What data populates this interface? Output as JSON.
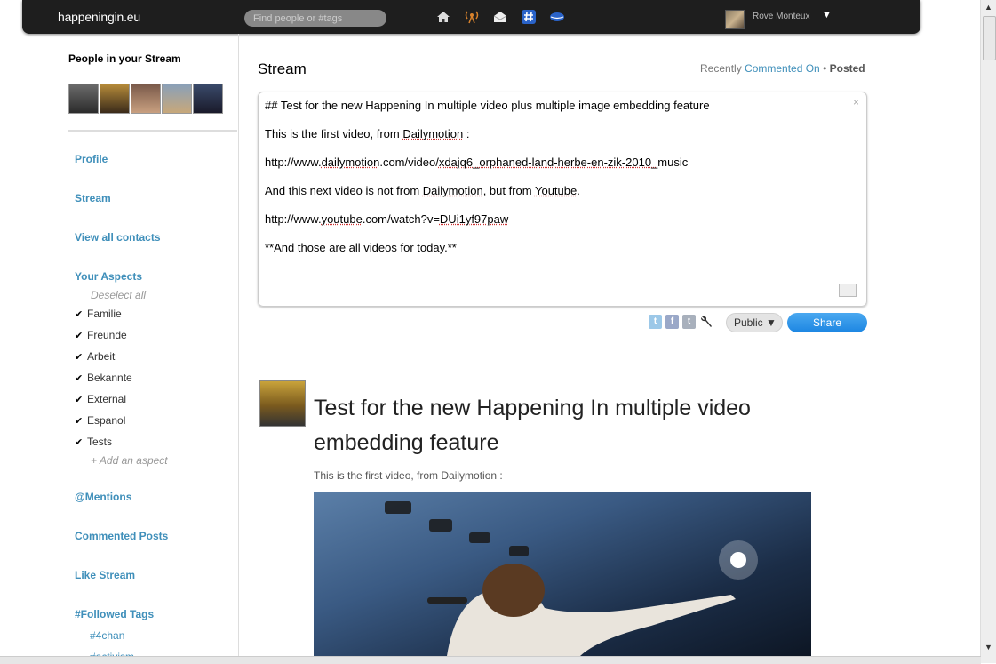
{
  "header": {
    "brand": "happeningin.eu",
    "search_placeholder": "Find people or #tags",
    "icons": [
      "home-icon",
      "broadcast-icon",
      "mail-icon",
      "hashtag-icon",
      "lips-icon"
    ],
    "user_name": "Rove Monteux",
    "user_menu_caret": "▼"
  },
  "sidebar": {
    "people_title": "People in your Stream",
    "nav": {
      "profile": "Profile",
      "stream": "Stream",
      "view_all_contacts": "View all contacts",
      "your_aspects": "Your Aspects",
      "deselect_all": "Deselect all",
      "add_aspect": "+ Add an aspect",
      "mentions": "@Mentions",
      "commented_posts": "Commented Posts",
      "like_stream": "Like Stream",
      "followed_tags": "#Followed Tags"
    },
    "aspects": [
      "Familie",
      "Freunde",
      "Arbeit",
      "Bekannte",
      "External",
      "Espanol",
      "Tests"
    ],
    "tags": [
      "#4chan",
      "#activism"
    ]
  },
  "main": {
    "title": "Stream",
    "sort": {
      "prefix": "Recently",
      "commented_on": "Commented On",
      "separator": " • ",
      "posted": "Posted"
    },
    "publisher": {
      "line1": "## Test for the new Happening In multiple video plus multiple image embedding feature",
      "line2_a": "This is the first video, from ",
      "line2_link": "Dailymotion",
      "line2_b": " :",
      "line3_a": "http://www.",
      "line3_link1": "dailymotion",
      "line3_b": ".com/video/",
      "line3_link2": "xdajq6_orphaned-land-herbe-en-zik-2010_",
      "line3_c": "music",
      "line4_a": "And this next video is not from ",
      "line4_link1": "Dailymotion",
      "line4_b": ", but from ",
      "line4_link2": "Youtube",
      "line4_c": ".",
      "line5_a": "http://www.",
      "line5_link1": "youtube",
      "line5_b": ".com/watch?v=",
      "line5_link2": "DUi1yf97paw",
      "line6": "**And those are all videos for today.**",
      "close": "×"
    },
    "services": [
      "twitter-icon",
      "facebook-icon",
      "tumblr-icon"
    ],
    "services_letters": {
      "facebook": "f",
      "tumblr": "t"
    },
    "public_label": "Public ▼",
    "share_label": "Share",
    "post": {
      "title": "Test for the new Happening In multiple video embedding feature",
      "text": "This is the first video, from Dailymotion :"
    }
  },
  "colors": {
    "link": "#3f8fba",
    "topbar": "#1e1e1e",
    "share": "#1c86e2"
  }
}
